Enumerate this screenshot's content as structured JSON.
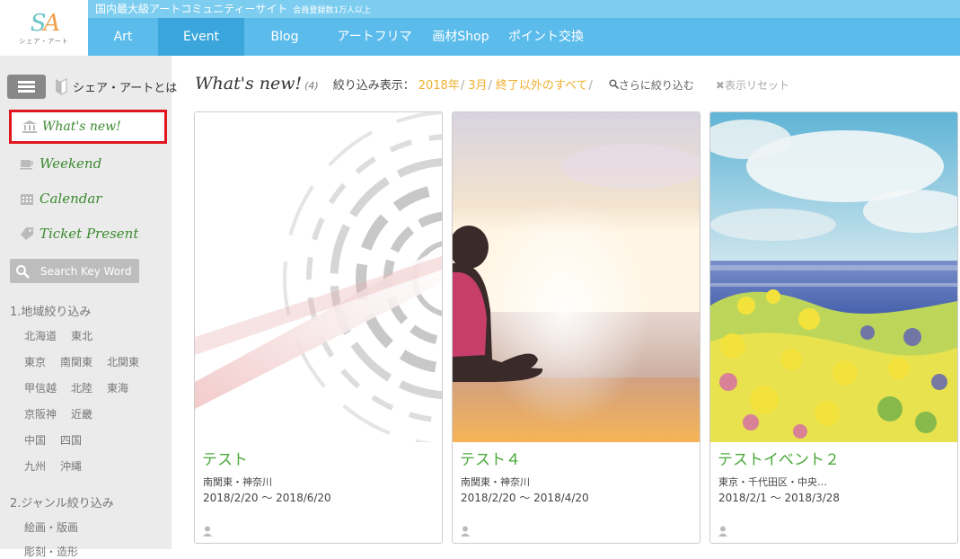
{
  "logo": {
    "letters_s": "S",
    "letters_a": "A",
    "sub": "シェア・アート"
  },
  "header": {
    "tagline": "国内最大級アートコミュニティーサイト",
    "member_note": "会員登録数1万人以上",
    "nav": [
      {
        "label": "Art"
      },
      {
        "label": "Event",
        "active": true
      },
      {
        "label": "Blog"
      },
      {
        "label": "アートフリマ"
      },
      {
        "label": "画材Shop"
      },
      {
        "label": "ポイント交換"
      }
    ]
  },
  "sidebar": {
    "about_label": "シェア・アートとは",
    "links": [
      {
        "label": "What's new!",
        "icon": "museum-icon",
        "selected": true
      },
      {
        "label": "Weekend",
        "icon": "cup-icon"
      },
      {
        "label": "Calendar",
        "icon": "calendar-icon"
      },
      {
        "label": "Ticket Present",
        "icon": "ticket-icon"
      }
    ],
    "search_placeholder": "Search Key Word",
    "region_title": "1.地域絞り込み",
    "regions": [
      [
        "北海道",
        "東北"
      ],
      [
        "東京",
        "南関東",
        "北関東"
      ],
      [
        "甲信越",
        "北陸",
        "東海"
      ],
      [
        "京阪神",
        "近畿"
      ],
      [
        "中国",
        "四国"
      ],
      [
        "九州",
        "沖縄"
      ]
    ],
    "genre_title": "2.ジャンル絞り込み",
    "genres": [
      "絵画・版画",
      "彫刻・造形"
    ]
  },
  "main": {
    "title": "What's new!",
    "count": "(4)",
    "filter_label": "絞り込み表示：",
    "filter_year_num": "2018",
    "filter_year_unit": "年",
    "filter_month": "3月",
    "filter_status": "終了以外のすべて",
    "narrow_label": "さらに絞り込む",
    "reset_label": "表示リセット",
    "cards": [
      {
        "title": "テスト",
        "place": "南関東・神奈川",
        "date": "2018/2/20 ～ 2018/6/20"
      },
      {
        "title": "テスト４",
        "place": "南関東・神奈川",
        "date": "2018/2/20 ～ 2018/4/20"
      },
      {
        "title": "テストイベント２",
        "place": "東京・千代田区・中央…",
        "date": "2018/2/1 ～ 2018/3/28"
      }
    ]
  },
  "colors": {
    "header": "#5bbcec",
    "active_nav": "#3aa6dc",
    "accent_green": "#4aa83a",
    "filter_orange": "#f0b030",
    "highlight_red": "#e0161e"
  }
}
